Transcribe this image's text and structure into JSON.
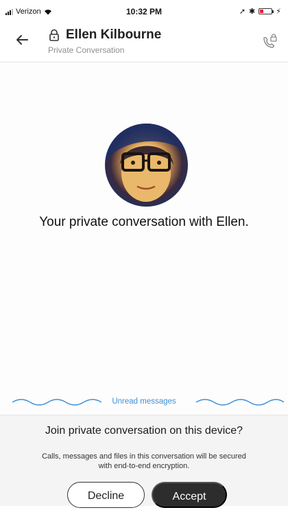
{
  "status_bar": {
    "carrier": "Verizon",
    "time": "10:32 PM"
  },
  "header": {
    "title": "Ellen Kilbourne",
    "subtitle": "Private Conversation",
    "back_icon": "arrow-left-icon",
    "lock_icon": "lock-icon",
    "call_icon": "private-call-icon"
  },
  "conversation": {
    "intro_text": "Your private conversation with Ellen.",
    "unread_label": "Unread messages"
  },
  "invite": {
    "title": "Join private conversation on this device?",
    "description": "Calls, messages and files in this conversation will be secured with end-to-end encryption.",
    "decline_label": "Decline",
    "accept_label": "Accept"
  },
  "colors": {
    "accent_blue": "#3f8fd6",
    "accept_button": "#2d2d2d",
    "battery_low": "#e0203a"
  }
}
